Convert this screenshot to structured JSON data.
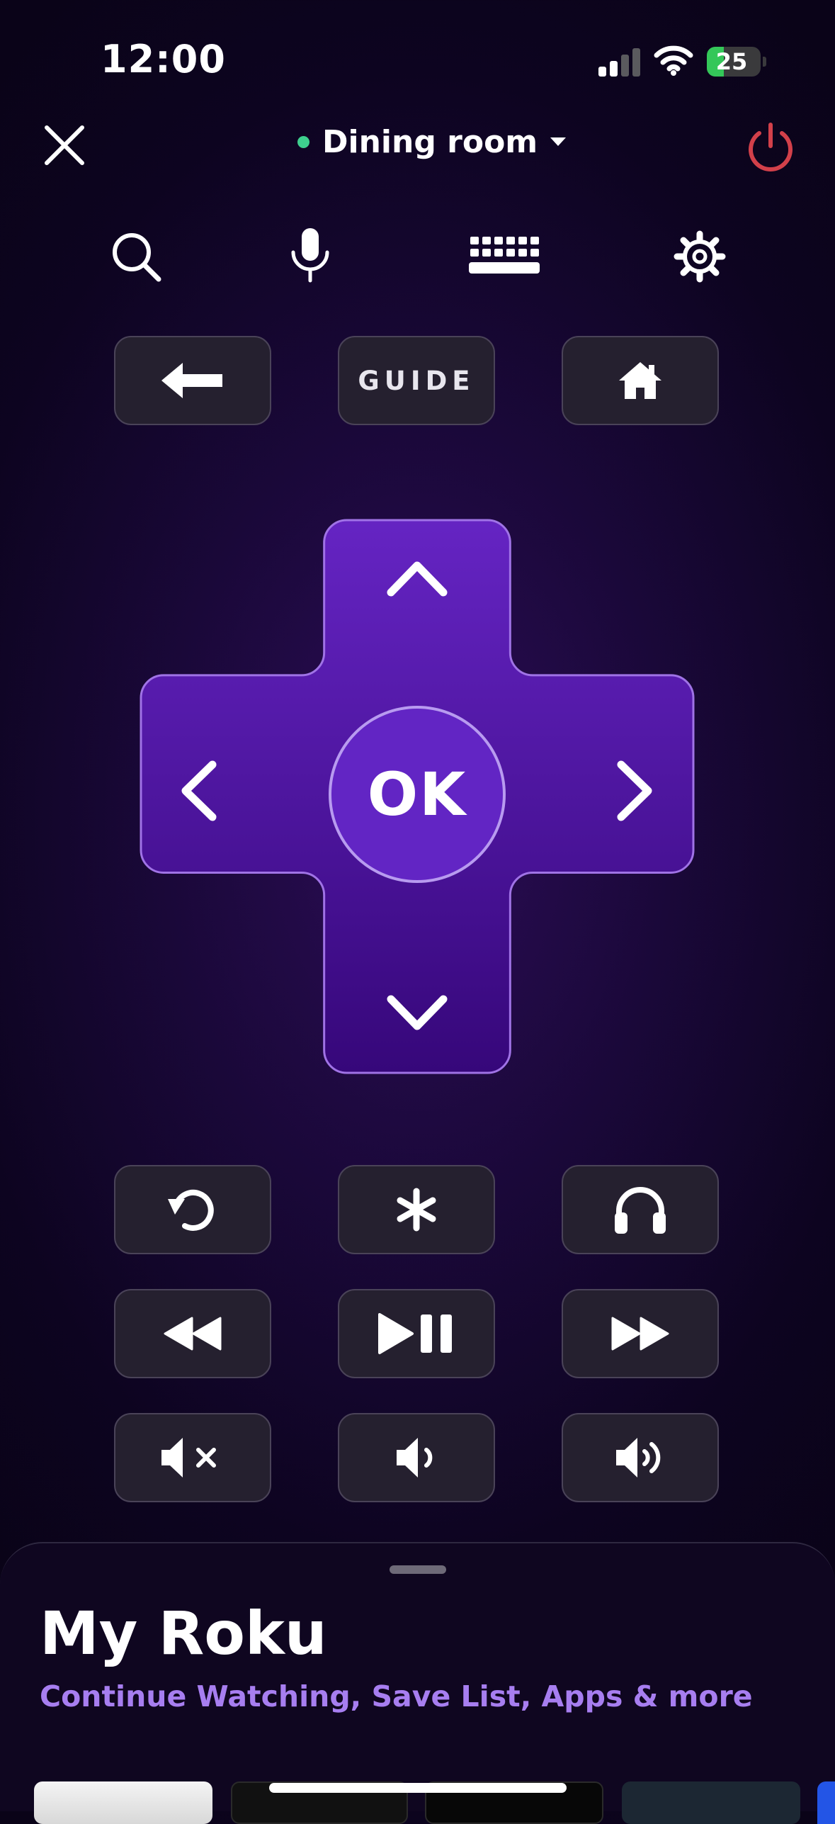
{
  "status_bar": {
    "time": "12:00",
    "battery_level": "25"
  },
  "header": {
    "device_name": "Dining room",
    "device_status_color": "#3ecf8e",
    "power_color": "#d2404a"
  },
  "utility_row": {
    "icons": [
      "search-icon",
      "microphone-icon",
      "keyboard-icon",
      "gear-icon"
    ]
  },
  "nav_row": {
    "back_icon": "arrow-left-icon",
    "guide_label": "GUIDE",
    "home_icon": "home-icon"
  },
  "dpad": {
    "ok_label": "OK",
    "directions": [
      "up",
      "left",
      "right",
      "down"
    ]
  },
  "controls": {
    "rows": [
      [
        "replay-icon",
        "asterisk-icon",
        "headphones-icon"
      ],
      [
        "rewind-icon",
        "play-pause-icon",
        "fast-forward-icon"
      ],
      [
        "mute-icon",
        "volume-down-icon",
        "volume-up-icon"
      ]
    ]
  },
  "sheet": {
    "title": "My Roku",
    "subtitle": "Continue Watching, Save List, Apps & more"
  },
  "colors": {
    "accent": "#6225c4",
    "subtitle": "#a77ef0",
    "button_bg": "#25202f"
  }
}
